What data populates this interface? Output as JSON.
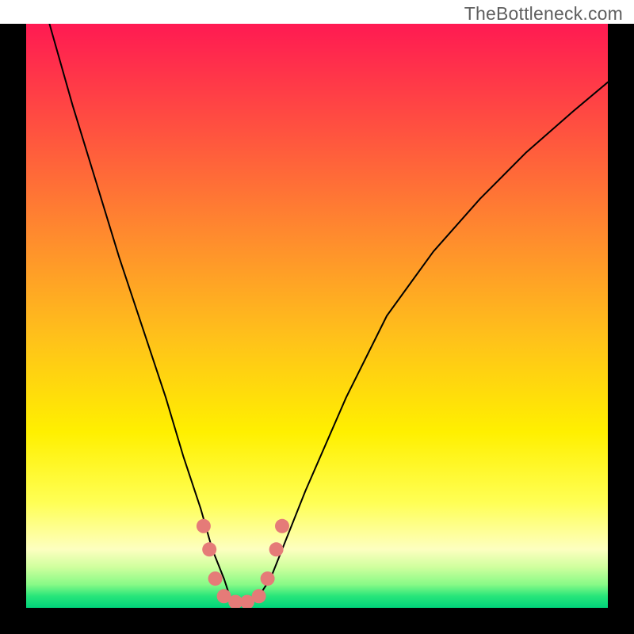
{
  "watermark": "TheBottleneck.com",
  "frame_color": "#000000",
  "gradient_stops": [
    {
      "pct": 0,
      "color": "#ff1a52"
    },
    {
      "pct": 18,
      "color": "#ff5140"
    },
    {
      "pct": 36,
      "color": "#ff8a2e"
    },
    {
      "pct": 54,
      "color": "#ffc21a"
    },
    {
      "pct": 70,
      "color": "#fff000"
    },
    {
      "pct": 82,
      "color": "#ffff55"
    },
    {
      "pct": 90,
      "color": "#fdffc0"
    },
    {
      "pct": 93,
      "color": "#d0ff9e"
    },
    {
      "pct": 96,
      "color": "#88fa87"
    },
    {
      "pct": 98,
      "color": "#27e57a"
    },
    {
      "pct": 100,
      "color": "#00d37a"
    }
  ],
  "chart_data": {
    "type": "line",
    "title": "",
    "xlabel": "",
    "ylabel": "",
    "xlim": [
      0,
      100
    ],
    "ylim": [
      0,
      100
    ],
    "grid": false,
    "legend_position": "none",
    "series": [
      {
        "name": "bottleneck-curve",
        "color": "#000000",
        "x": [
          4,
          8,
          12,
          16,
          20,
          24,
          27,
          30,
          32,
          34,
          35,
          36,
          38,
          40,
          42,
          44,
          48,
          55,
          62,
          70,
          78,
          86,
          94,
          100
        ],
        "y": [
          100,
          86,
          73,
          60,
          48,
          36,
          26,
          17,
          10,
          5,
          2,
          1,
          1,
          2,
          5,
          10,
          20,
          36,
          50,
          61,
          70,
          78,
          85,
          90
        ]
      }
    ],
    "markers": [
      {
        "name": "dot",
        "x": 30.5,
        "y": 14,
        "r": 9,
        "color": "#e57b78"
      },
      {
        "name": "dot",
        "x": 31.5,
        "y": 10,
        "r": 9,
        "color": "#e57b78"
      },
      {
        "name": "dot",
        "x": 32.5,
        "y": 5,
        "r": 9,
        "color": "#e57b78"
      },
      {
        "name": "dot",
        "x": 34.0,
        "y": 2,
        "r": 9,
        "color": "#e57b78"
      },
      {
        "name": "dot",
        "x": 36.0,
        "y": 1,
        "r": 9,
        "color": "#e57b78"
      },
      {
        "name": "dot",
        "x": 38.0,
        "y": 1,
        "r": 9,
        "color": "#e57b78"
      },
      {
        "name": "dot",
        "x": 40.0,
        "y": 2,
        "r": 9,
        "color": "#e57b78"
      },
      {
        "name": "dot",
        "x": 41.5,
        "y": 5,
        "r": 9,
        "color": "#e57b78"
      },
      {
        "name": "dot",
        "x": 43.0,
        "y": 10,
        "r": 9,
        "color": "#e57b78"
      },
      {
        "name": "dot",
        "x": 44.0,
        "y": 14,
        "r": 9,
        "color": "#e57b78"
      }
    ]
  }
}
